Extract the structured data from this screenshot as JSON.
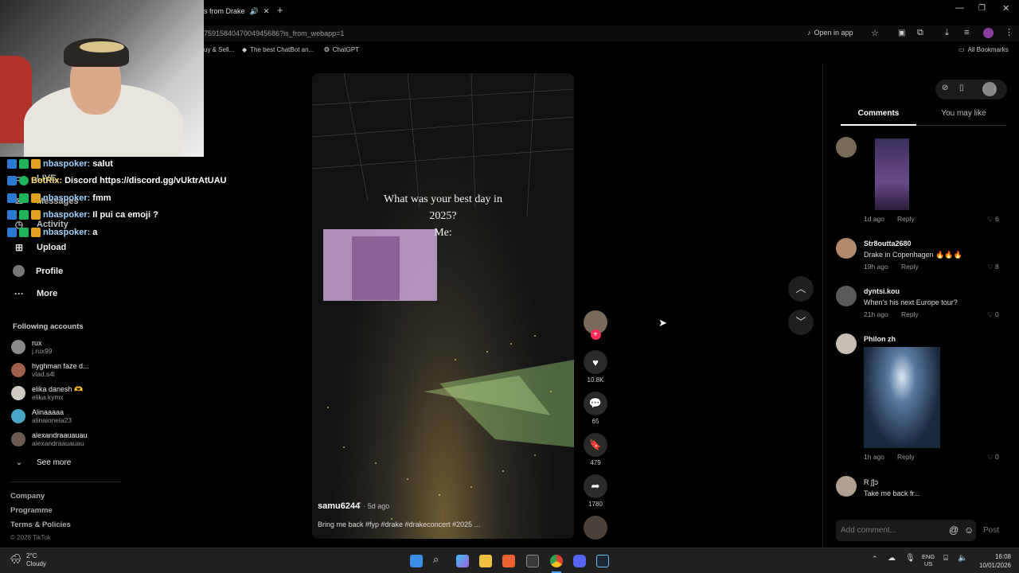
{
  "browser": {
    "tab_title": "s from Drake",
    "url": "7591584047004945686?is_from_webapp=1",
    "open_in_app": "Open in app",
    "bookmarks": [
      "uy & Sell...",
      "The best ChatBot an...",
      "ChatGPT"
    ],
    "all_bookmarks": "All Bookmarks"
  },
  "chat": [
    {
      "user": "nbaspoker:",
      "msg": "salut"
    },
    {
      "user": "BotRix:",
      "msg": "Discord https://discord.gg/vUktrAtUAU"
    },
    {
      "user": "nbaspoker:",
      "msg": "fmm"
    },
    {
      "user": "nbaspoker:",
      "msg": "Il pui ca emoji ?"
    },
    {
      "user": "nbaspoker:",
      "msg": "a"
    }
  ],
  "sidebar": {
    "partial_items": [
      "LIVE",
      "Messages",
      "Activity"
    ],
    "items": [
      {
        "label": "Upload",
        "icon": "plus-square-icon"
      },
      {
        "label": "Profile",
        "icon": "avatar-icon"
      },
      {
        "label": "More",
        "icon": "more-icon"
      }
    ],
    "following_title": "Following accounts",
    "following": [
      {
        "name": "rux",
        "handle": "j.rux99",
        "color": "#8a8a8a"
      },
      {
        "name": "hyghman faze d...",
        "handle": "vlad.s4l",
        "color": "#a06050"
      },
      {
        "name": "elika danesh 🫶",
        "handle": "elika.kymx",
        "color": "#cfc9c2"
      },
      {
        "name": "Alinaaaaa",
        "handle": "alinaionela23",
        "color": "#4aa6c7"
      },
      {
        "name": "alexandraauauau",
        "handle": "alexandraauauau",
        "color": "#6a5a50"
      }
    ],
    "see_more": "See more",
    "footer": [
      "Company",
      "Programme",
      "Terms & Policies"
    ],
    "copyright": "© 2026 TikTok"
  },
  "video": {
    "overlay_line1": "What was your best day in",
    "overlay_line2": "2025?",
    "overlay_line3": "Me:",
    "author": "samu6244",
    "age": "· 5d ago",
    "caption": "Bring me back #fyp #drake #drakeconcert #2025 ..."
  },
  "actions": {
    "likes": "10.8K",
    "comments": "65",
    "saves": "479",
    "shares": "1780"
  },
  "panel": {
    "tabs": [
      "Comments",
      "You may like"
    ],
    "comments": [
      {
        "name": "",
        "text": "",
        "time": "1d ago",
        "reply": "Reply",
        "likes": "6"
      },
      {
        "name": "Str8outta2680",
        "text": "Drake in Copenhagen 🔥🔥🔥",
        "time": "19h ago",
        "reply": "Reply",
        "likes": "8"
      },
      {
        "name": "dyntsi.kou",
        "text": "When's his next Europe tour?",
        "time": "21h ago",
        "reply": "Reply",
        "likes": "0"
      },
      {
        "name": "Philon zh",
        "text": "",
        "time": "1h ago",
        "reply": "Reply",
        "likes": "0"
      },
      {
        "name": "R ʃ]ɔ",
        "text": "Take me back fr...",
        "time": "",
        "reply": "",
        "likes": ""
      }
    ],
    "add_comment_placeholder": "Add comment...",
    "post": "Post"
  },
  "taskbar": {
    "temp": "2°C",
    "weather": "Cloudy",
    "lang1": "ENG",
    "lang2": "US",
    "time": "16:08",
    "date": "10/01/2026"
  }
}
